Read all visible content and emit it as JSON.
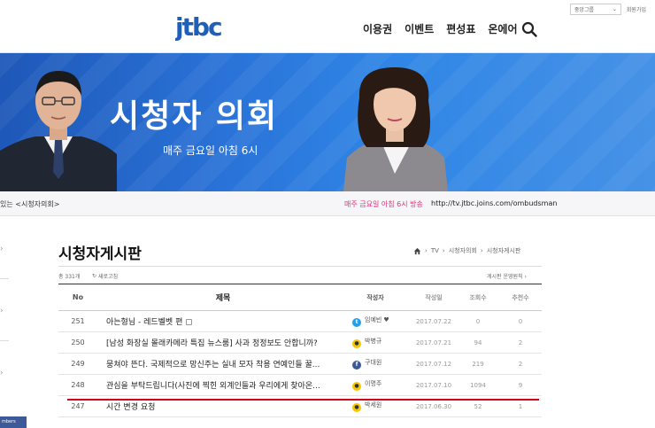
{
  "header": {
    "logo_text": "JTBC",
    "nav": [
      "이용권",
      "이벤트",
      "편성표",
      "온에어"
    ],
    "util_dropdown": "중앙그룹",
    "util_link": "회원가입"
  },
  "banner": {
    "title": "시청자 의회",
    "subtitle": "매주 금요일 아침 6시",
    "colors": {
      "bg_left": "#1e58b8",
      "bg_right": "#2f80de"
    }
  },
  "ticker": {
    "left_text": "있는 <시청자의회>",
    "broadcast_text": "매주 금요일 아침 6시 방송",
    "url": "http://tv.jtbc.joins.com/ombudsman"
  },
  "board": {
    "title": "시청자게시판",
    "breadcrumb": [
      "TV",
      "시청자의회",
      "시청자게시판"
    ],
    "count": "총 331개",
    "refresh_label": "새로고침",
    "rules_label": "게시판 운영원칙",
    "columns": [
      "No",
      "제목",
      "작성자",
      "작성일",
      "조회수",
      "추천수"
    ],
    "rows": [
      {
        "no": "251",
        "subject": "아는형님 - 레드벨벳 편",
        "author": "임예빈",
        "author_icon": "twitter",
        "date": "2017.07.22",
        "views": "0",
        "recs": "0",
        "locked": true,
        "heart": true
      },
      {
        "no": "250",
        "subject": "[남성 화장실 몰래카메라 특집 뉴스룸] 사과 정정보도 안합니까?",
        "author": "박병규",
        "author_icon": "kakao",
        "date": "2017.07.21",
        "views": "94",
        "recs": "2"
      },
      {
        "no": "249",
        "subject": "뭉쳐야 뜬다. 국제적으로 망신주는 실내 모자 착용 연예인들 꿀...",
        "author": "구대원",
        "author_icon": "facebook",
        "date": "2017.07.12",
        "views": "219",
        "recs": "2"
      },
      {
        "no": "248",
        "subject": "관심을 부탁드립니다(사진에 찍힌 외계인들과 우리에게 찾아온...",
        "author": "이명주",
        "author_icon": "kakao",
        "date": "2017.07.10",
        "views": "1094",
        "recs": "9"
      },
      {
        "no": "247",
        "subject": "시간 변경 요청",
        "author": "박세원",
        "author_icon": "kakao",
        "date": "2017.06.30",
        "views": "52",
        "recs": "1"
      }
    ]
  },
  "sidebar": {
    "tag": "mbers"
  }
}
